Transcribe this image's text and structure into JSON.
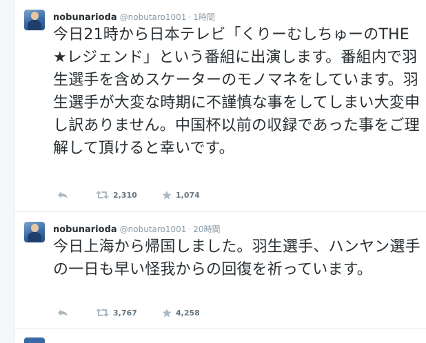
{
  "tweets": [
    {
      "fullname": "nobunarioda",
      "username": "@nobutaro1001",
      "separator": "·",
      "time": "1時間",
      "text": "今日21時から日本テレビ「くりーむしちゅーのTHE★レジェンド」という番組に出演します。番組内で羽生選手を含めスケーターのモノマネをしています。羽生選手が大変な時期に不謹慎な事をしてしまい大変申し訳ありません。中国杯以前の収録であった事をご理解して頂けると幸いです。",
      "retweets": "2,310",
      "favorites": "1,074"
    },
    {
      "fullname": "nobunarioda",
      "username": "@nobutaro1001",
      "separator": "·",
      "time": "20時間",
      "text": "今日上海から帰国しました。羽生選手、ハンヤン選手の一日も早い怪我からの回復を祈っています。",
      "retweets": "3,767",
      "favorites": "4,258"
    }
  ],
  "icons": {
    "avatar": "avatar",
    "reply": "reply-icon",
    "retweet": "retweet-icon",
    "favorite": "star-icon"
  },
  "colors": {
    "muted": "#aab8c2",
    "text": "#292f33",
    "border": "#e1e8ed"
  }
}
